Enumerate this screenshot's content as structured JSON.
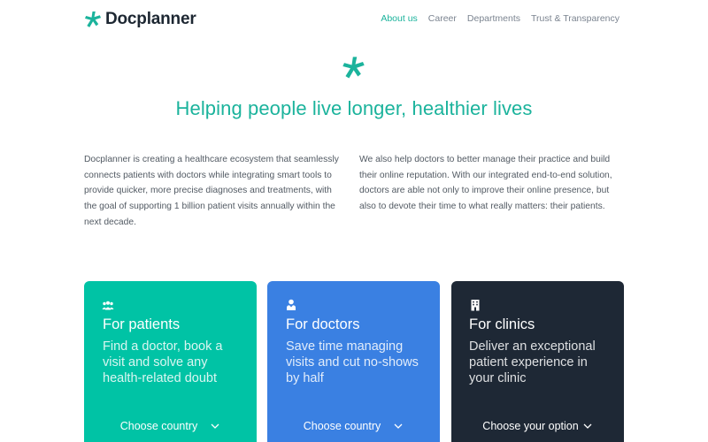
{
  "header": {
    "brand": "Docplanner",
    "nav": [
      {
        "label": "About us",
        "active": true
      },
      {
        "label": "Career",
        "active": false
      },
      {
        "label": "Departments",
        "active": false
      },
      {
        "label": "Trust & Transparency",
        "active": false
      }
    ]
  },
  "hero": {
    "icon": "docplanner-logo-icon",
    "headline": "Helping people live longer, healthier lives"
  },
  "intro": {
    "left": "Docplanner is creating a healthcare ecosystem that seamlessly connects patients with doctors while integrating smart tools to provide quicker, more precise diagnoses and treatments, with the goal of supporting 1 billion patient visits annually within the next decade.",
    "right": "We also help doctors to better manage their practice and build their online reputation. With our integrated end-to-end solution, doctors are able not only to improve their online presence, but also to devote their time to what really matters: their patients."
  },
  "cards": [
    {
      "icon": "people-group-icon",
      "title": "For patients",
      "description": "Find a doctor, book a visit and solve any health-related doubt",
      "select": "Choose country",
      "color": "#00c3a5"
    },
    {
      "icon": "doctor-icon",
      "title": "For doctors",
      "description": "Save time managing visits and cut no-shows by half",
      "select": "Choose country",
      "color": "#3a80e2"
    },
    {
      "icon": "building-icon",
      "title": "For clinics",
      "description": "Deliver an exceptional patient experience in your clinic",
      "select": "Choose your option",
      "color": "#1e2835"
    }
  ],
  "colors": {
    "brand": "#1bb39c",
    "text_dark": "#1d2732"
  }
}
